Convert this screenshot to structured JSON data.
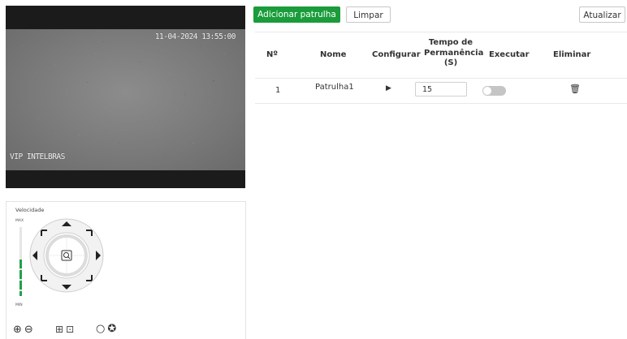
{
  "video": {
    "timestamp": "11-04-2024 13:55:00",
    "camera_name": "VIP INTELBRAS"
  },
  "ptz": {
    "speed_label": "Velocidade",
    "speed_max": "MAX",
    "speed_min": "MIN",
    "speed_level": 0.6,
    "icons": {
      "zoom_in": "zoom-in-icon",
      "zoom_out": "zoom-out-icon",
      "focus_near": "focus-near-icon",
      "focus_far": "focus-far-icon",
      "iris_open": "iris-open-icon",
      "iris_close": "iris-close-icon"
    }
  },
  "toolbar": {
    "add_label": "Adicionar patrulha",
    "clear_label": "Limpar",
    "refresh_label": "Atualizar"
  },
  "table": {
    "headers": {
      "no": "Nº",
      "name": "Nome",
      "configure": "Configurar",
      "dwell_line1": "Tempo de",
      "dwell_line2": "Permanência",
      "dwell_line3": "(S)",
      "execute": "Executar",
      "delete": "Eliminar"
    },
    "rows": [
      {
        "no": "1",
        "name": "Patrulha1",
        "dwell": "15",
        "execute": false
      }
    ]
  },
  "colors": {
    "accent": "#1a9c3b",
    "speed_bar": "#21a04b",
    "toggle_off": "#c5c5c5"
  }
}
